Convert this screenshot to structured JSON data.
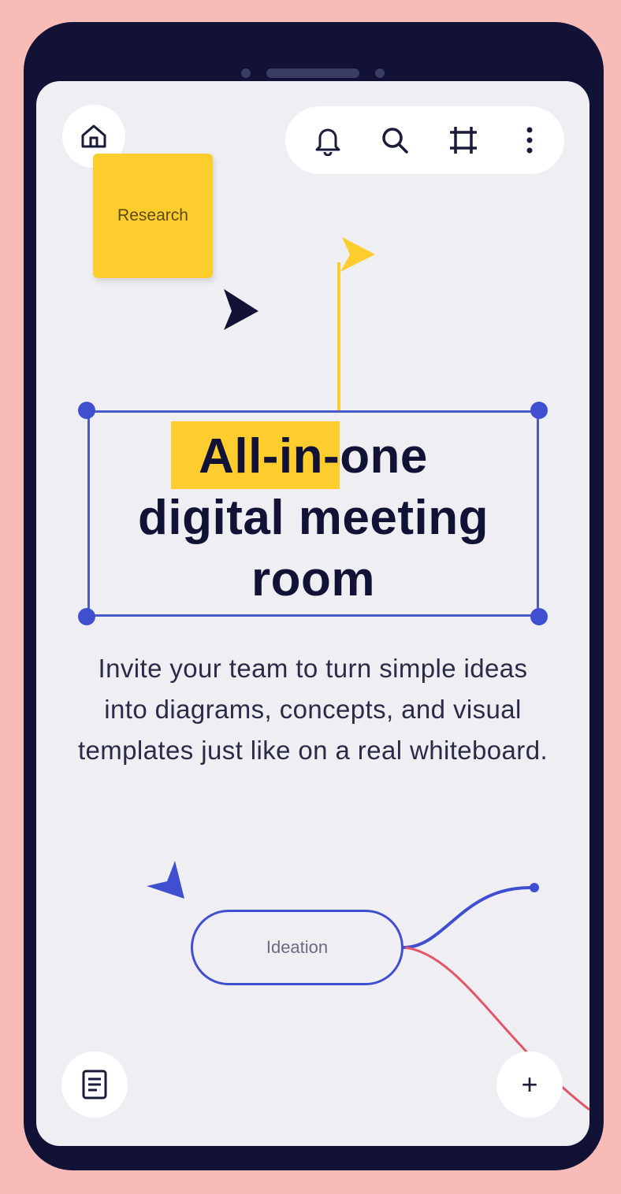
{
  "board": {
    "sticky_note": "Research",
    "headline_highlight": "All-in-",
    "headline_rest": "one",
    "headline_line2": "digital meeting",
    "headline_line3": "room",
    "description": "Invite your team to turn simple ideas into diagrams, concepts, and visual templates just like on a real whiteboard.",
    "mind_map_node": "Ideation"
  },
  "toolbar": {
    "icons": [
      "bell-icon",
      "search-icon",
      "frame-icon",
      "more-vertical-icon"
    ]
  },
  "controls": {
    "home_icon": "home-icon",
    "notes_icon": "notes-icon",
    "add_label": "+"
  },
  "colors": {
    "background": "#f8bcb8",
    "phone": "#111236",
    "canvas": "#efeff3",
    "sticky": "#fdcd2e",
    "selection": "#3f4fd0",
    "connector_red": "#e0566a"
  }
}
